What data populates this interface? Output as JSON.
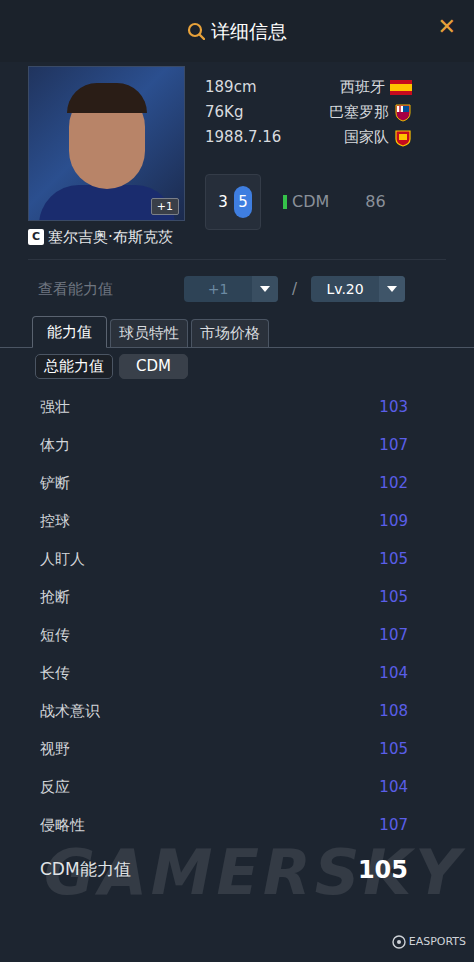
{
  "window": {
    "title": "详细信息",
    "close": "✕"
  },
  "player": {
    "name": "塞尔吉奥·布斯克茨",
    "card_badge": "C",
    "upgrade": "+1",
    "height": "189cm",
    "weight": "76Kg",
    "birth": "1988.7.16",
    "nation": "西班牙",
    "club": "巴塞罗那",
    "team": "国家队",
    "feet": [
      {
        "label": "3",
        "selected": false
      },
      {
        "label": "5",
        "selected": true
      }
    ],
    "position": "CDM",
    "rating": "86"
  },
  "view": {
    "label": "查看能力值",
    "upgrade": "+1",
    "separator": "/",
    "level": "Lv.20"
  },
  "tabs": [
    {
      "label": "能力值",
      "selected": true
    },
    {
      "label": "球员特性",
      "selected": false
    },
    {
      "label": "市场价格",
      "selected": false
    }
  ],
  "subtabs": [
    {
      "label": "总能力值",
      "selected": true
    },
    {
      "label": "CDM",
      "selected": false
    }
  ],
  "stats": [
    {
      "label": "强壮",
      "value": "103"
    },
    {
      "label": "体力",
      "value": "107"
    },
    {
      "label": "铲断",
      "value": "102"
    },
    {
      "label": "控球",
      "value": "109"
    },
    {
      "label": "人盯人",
      "value": "105"
    },
    {
      "label": "抢断",
      "value": "105"
    },
    {
      "label": "短传",
      "value": "107"
    },
    {
      "label": "长传",
      "value": "104"
    },
    {
      "label": "战术意识",
      "value": "108"
    },
    {
      "label": "视野",
      "value": "105"
    },
    {
      "label": "反应",
      "value": "104"
    },
    {
      "label": "侵略性",
      "value": "107"
    }
  ],
  "summary": {
    "label": "CDM能力值",
    "value": "105"
  },
  "watermark": "GAMERSKY",
  "source": "EASPORTS"
}
